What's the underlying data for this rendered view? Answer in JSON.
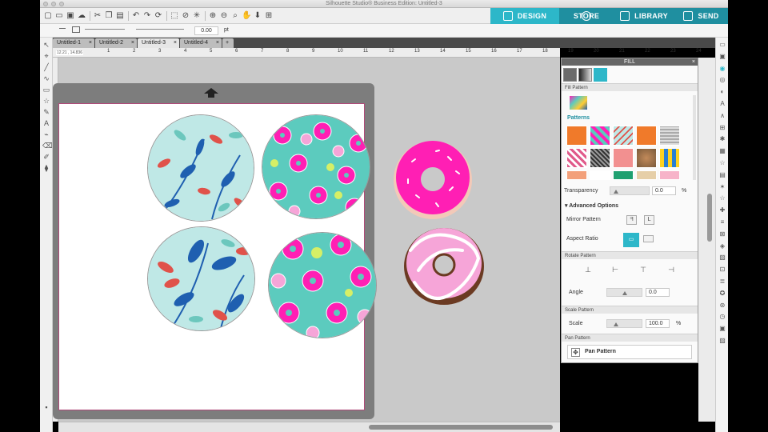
{
  "window": {
    "title": "Silhouette Studio® Business Edition: Untitled-3"
  },
  "modes": [
    {
      "label": "DESIGN",
      "color": "#2db7c9"
    },
    {
      "label": "STORE",
      "color": "#1f8fa0"
    },
    {
      "label": "LIBRARY",
      "color": "#1f8fa0"
    },
    {
      "label": "SEND",
      "color": "#1f8fa0"
    }
  ],
  "options": {
    "line_width": "0.00",
    "unit": "pt"
  },
  "tabs": [
    {
      "label": "Untitled-1"
    },
    {
      "label": "Untitled-2"
    },
    {
      "label": "Untitled-3",
      "active": true
    },
    {
      "label": "Untitled-4"
    }
  ],
  "ruler": {
    "coords": "12.21 , 14.836",
    "marks": [
      "1",
      "2",
      "3",
      "4",
      "5",
      "6",
      "7",
      "8",
      "9",
      "10",
      "11",
      "12",
      "13",
      "14",
      "15",
      "16",
      "17",
      "18",
      "19",
      "20",
      "21",
      "22",
      "23",
      "24",
      "25"
    ]
  },
  "fill_panel": {
    "title": "FILL",
    "fill_pattern_label": "Fill Pattern",
    "patterns_label": "Patterns",
    "transparency_label": "Transparency",
    "transparency_value": "0.0",
    "transparency_unit": "%",
    "advanced_label": "Advanced Options",
    "mirror_label": "Mirror Pattern",
    "aspect_label": "Aspect Ratio",
    "rotate_head": "Rotate Pattern",
    "angle_label": "Angle",
    "angle_value": "0.0",
    "scale_head": "Scale Pattern",
    "scale_label": "Scale",
    "scale_value": "100.0",
    "scale_unit": "%",
    "pan_head": "Pan Pattern",
    "pan_button": "Pan Pattern"
  },
  "colors": {
    "accent": "#2db7c9",
    "pink": "#ff1fb4",
    "mint": "#5ccbbe",
    "light_blue": "#bfe8e6",
    "leaf_blue": "#1f5fb0",
    "leaf_red": "#e0524a"
  }
}
